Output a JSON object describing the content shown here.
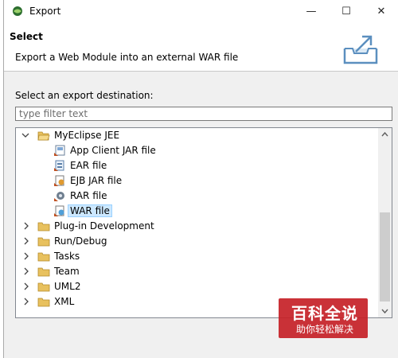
{
  "window": {
    "title": "Export",
    "minimize": "—",
    "maximize": "☐",
    "close": "✕"
  },
  "header": {
    "title": "Select",
    "description": "Export a Web Module into an external WAR file",
    "icon": "export-tray-icon"
  },
  "destination": {
    "label": "Select an export destination:",
    "filter_placeholder": "type filter text",
    "filter_value": ""
  },
  "tree": {
    "items": [
      {
        "label": "MyEclipse JEE",
        "type": "folder",
        "expanded": true
      },
      {
        "label": "App Client JAR file",
        "type": "file",
        "icon": "app-client-jar-icon"
      },
      {
        "label": "EAR file",
        "type": "file",
        "icon": "ear-file-icon"
      },
      {
        "label": "EJB JAR file",
        "type": "file",
        "icon": "ejb-jar-icon"
      },
      {
        "label": "RAR file",
        "type": "file",
        "icon": "rar-file-icon"
      },
      {
        "label": "WAR file",
        "type": "file",
        "icon": "war-file-icon",
        "selected": true
      },
      {
        "label": "Plug-in Development",
        "type": "folder",
        "expanded": false
      },
      {
        "label": "Run/Debug",
        "type": "folder",
        "expanded": false
      },
      {
        "label": "Tasks",
        "type": "folder",
        "expanded": false
      },
      {
        "label": "Team",
        "type": "folder",
        "expanded": false
      },
      {
        "label": "UML2",
        "type": "folder",
        "expanded": false
      },
      {
        "label": "XML",
        "type": "folder",
        "expanded": false
      }
    ]
  },
  "watermark": {
    "title": "百科全说",
    "subtitle": "助你轻松解决",
    "color": "#c62127"
  },
  "colors": {
    "selection": "#cce8ff",
    "folder": "#e8c15e"
  }
}
